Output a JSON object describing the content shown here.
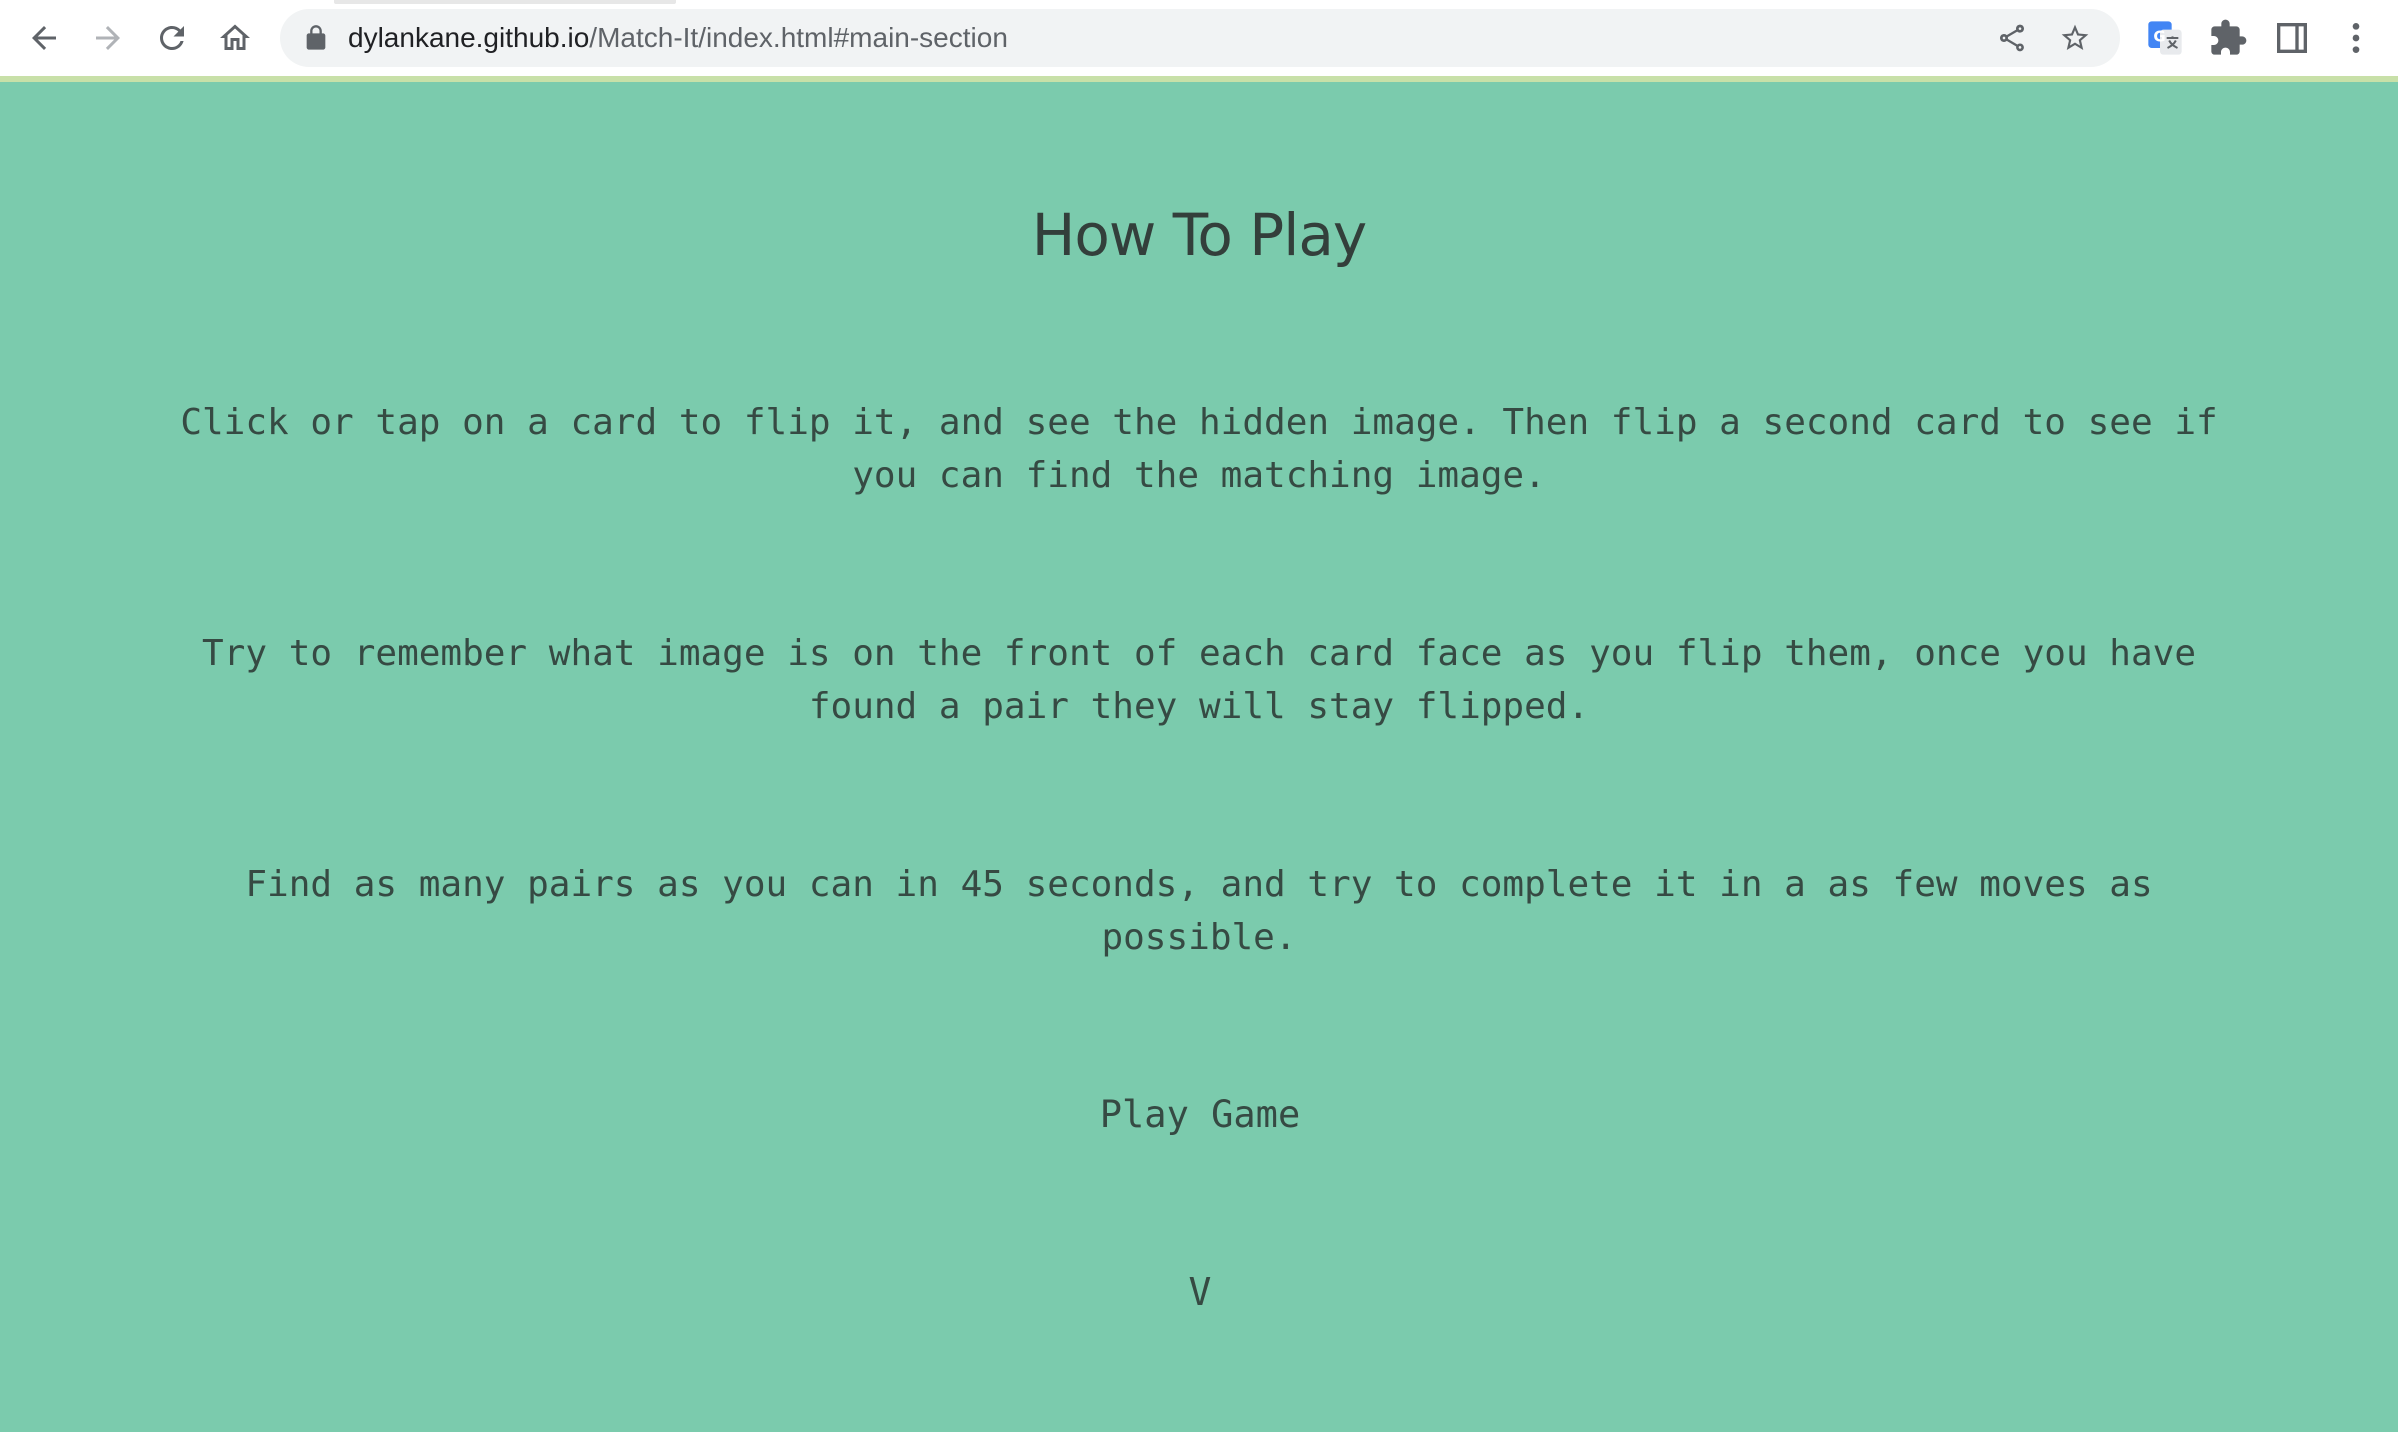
{
  "browser": {
    "url_host": "dylankane.github.io",
    "url_path": "/Match-It/index.html#main-section",
    "icons": {
      "back": "arrow-left-icon",
      "forward": "arrow-right-icon",
      "reload": "reload-icon",
      "home": "home-icon",
      "lock": "lock-icon",
      "share": "share-icon",
      "bookmark": "star-icon",
      "translate": "google-translate-icon",
      "extensions": "puzzle-icon",
      "side_panel": "side-panel-icon",
      "menu": "kebab-menu-icon"
    }
  },
  "page": {
    "title": "How To Play",
    "paragraphs": [
      "Click or tap on a card to flip it, and see the hidden image. Then flip a second card to see if you can find the matching image.",
      "Try to remember what image is on the front of each card face as you flip them, once you have found a pair they will stay flipped.",
      "Find as many pairs as you can in 45 seconds, and try to complete it in a as few moves as possible."
    ],
    "play_button": "Play Game",
    "scroll_indicator": "V"
  },
  "colors": {
    "background": "#7bcbad",
    "text": "#364a43",
    "load_bar": "#c8e0a8"
  }
}
